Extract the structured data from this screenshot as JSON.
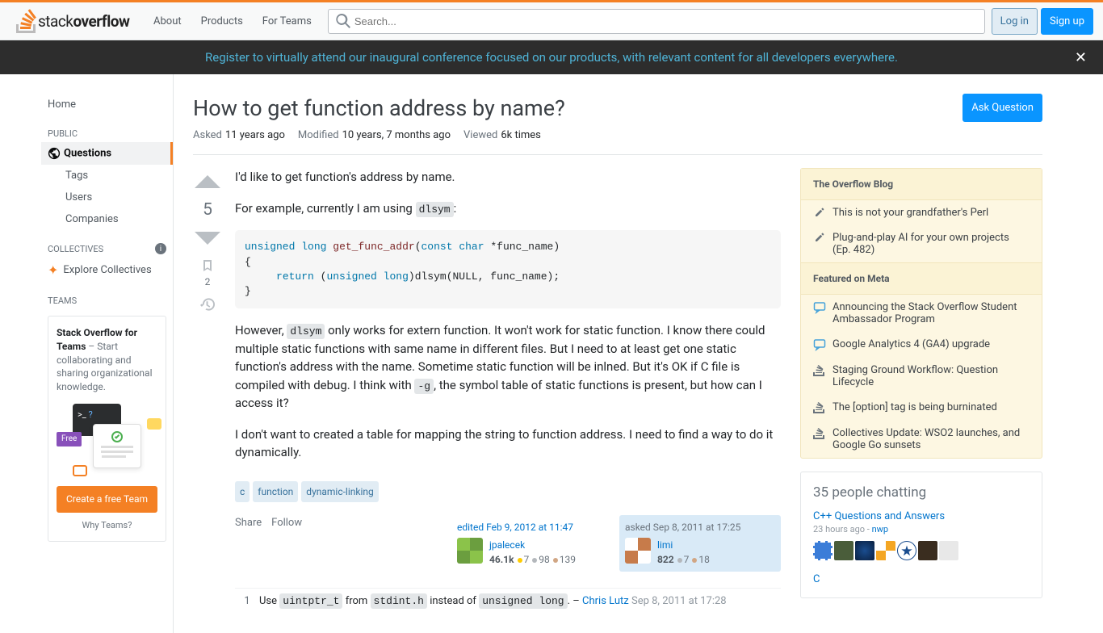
{
  "header": {
    "nav": {
      "about": "About",
      "products": "Products",
      "for_teams": "For Teams"
    },
    "search_placeholder": "Search...",
    "login": "Log in",
    "signup": "Sign up"
  },
  "banner": {
    "text": "Register to virtually attend our inaugural conference focused on our products, with relevant content for all developers everywhere."
  },
  "sidebar": {
    "home": "Home",
    "public": "PUBLIC",
    "questions": "Questions",
    "tags": "Tags",
    "users": "Users",
    "companies": "Companies",
    "collectives": "COLLECTIVES",
    "explore": "Explore Collectives",
    "teams": "TEAMS",
    "teams_box": {
      "bold": "Stack Overflow for Teams",
      "rest": " – Start collaborating and sharing organizational knowledge.",
      "free": "Free",
      "btn": "Create a free Team",
      "why": "Why Teams?"
    }
  },
  "question": {
    "title": "How to get function address by name?",
    "ask_btn": "Ask Question",
    "meta": {
      "asked_l": "Asked",
      "asked_v": "11 years ago",
      "mod_l": "Modified",
      "mod_v": "10 years, 7 months ago",
      "view_l": "Viewed",
      "view_v": "6k times"
    },
    "vote_count": "5",
    "save_count": "2",
    "body": {
      "p1": "I'd like to get function's address by name.",
      "p2a": "For example, currently I am using ",
      "p2code": "dlsym",
      "p2b": ":",
      "code": "unsigned long get_func_addr(const char *func_name)\n{\n     return (unsigned long)dlsym(NULL, func_name);\n}",
      "p3a": "However, ",
      "p3code1": "dlsym",
      "p3b": " only works for extern function. It won't work for static function. I know there could multiple static functions with same name in different files. But I need to at least get one static function's address with the name. Sometime static function will be inlned. But it's OK if C file is compiled with debug. I think with ",
      "p3code2": "-g",
      "p3c": ", the symbol table of static functions is present, but how can I access it?",
      "p4": "I don't want to created a table for mapping the string to function address. I need to find a way to do it dynamically."
    },
    "tags": [
      "c",
      "function",
      "dynamic-linking"
    ],
    "actions": {
      "share": "Share",
      "follow": "Follow"
    },
    "editor": {
      "time": "edited Feb 9, 2012 at 11:47",
      "name": "jpalecek",
      "rep": "46.1k",
      "gold": "7",
      "silver": "98",
      "bronze": "139"
    },
    "owner": {
      "time": "asked Sep 8, 2011 at 17:25",
      "name": "limi",
      "rep": "822",
      "silver": "7",
      "bronze": "18"
    },
    "comment": {
      "votes": "1",
      "t1": "Use ",
      "c1": "uintptr_t",
      "t2": " from ",
      "c2": "stdint.h",
      "t3": " instead of ",
      "c3": "unsigned long",
      "t4": ". – ",
      "user": "Chris Lutz",
      "date": "Sep 8, 2011 at 17:28"
    }
  },
  "rightbar": {
    "blog_h": "The Overflow Blog",
    "blog": [
      "This is not your grandfather's Perl",
      "Plug-and-play AI for your own projects (Ep. 482)"
    ],
    "meta_h": "Featured on Meta",
    "meta": [
      "Announcing the Stack Overflow Student Ambassador Program",
      "Google Analytics 4 (GA4) upgrade",
      "Staging Ground Workflow: Question Lifecycle",
      "The [option] tag is being burninated",
      "Collectives Update: WSO2 launches, and Google Go sunsets"
    ],
    "chat_h": "35 people chatting",
    "room1": {
      "name": "C++ Questions and Answers",
      "time": "23 hours ago - ",
      "user": "nwp"
    },
    "room2": {
      "name": "C"
    }
  }
}
